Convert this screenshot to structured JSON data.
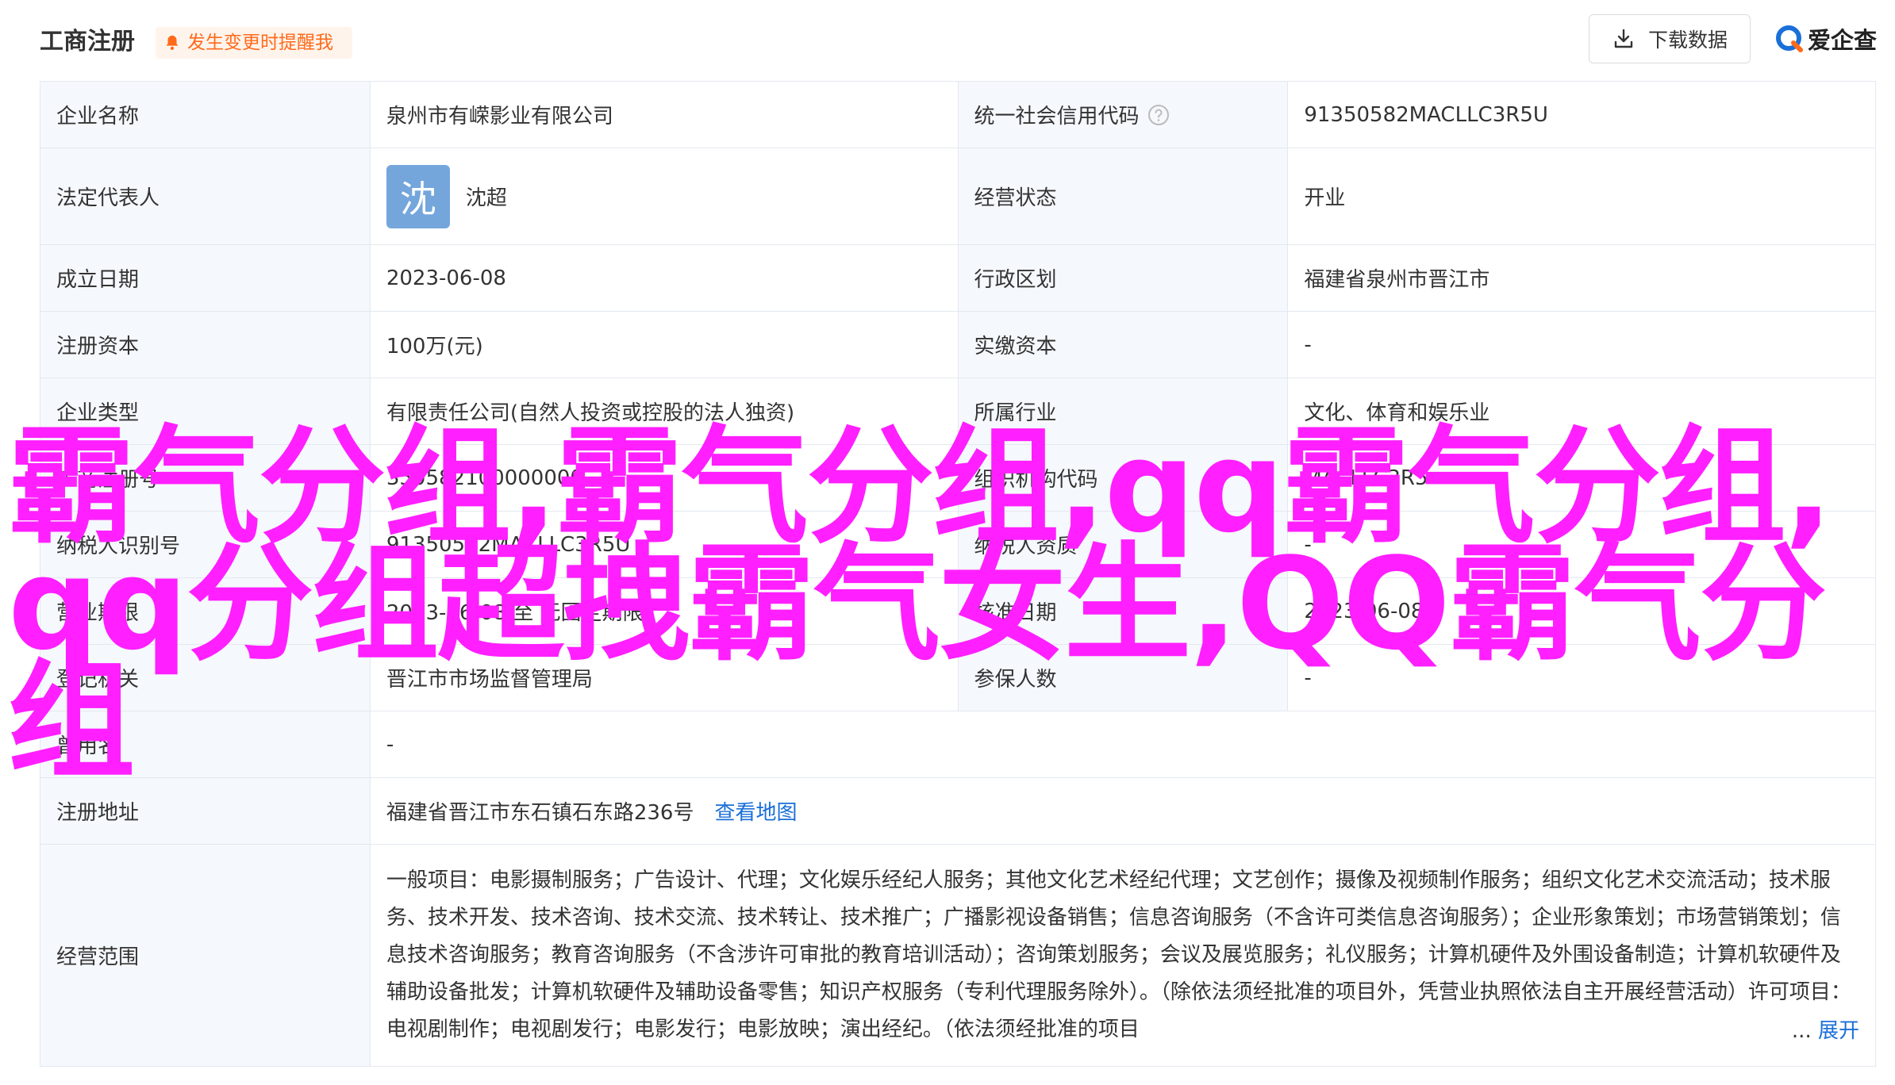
{
  "header": {
    "title": "工商注册",
    "alert_label": "发生变更时提醒我",
    "download_label": "下载数据",
    "brand_name": "爱企查",
    "brand_color": "#1a6fd8",
    "alert_color": "#ff6a1a"
  },
  "rows": [
    {
      "l1": "企业名称",
      "v1": "泉州市有嵘影业有限公司",
      "l2": "统一社会信用代码",
      "v2": "91350582MACLLC3R5U"
    },
    {
      "l1": "法定代表人",
      "avatar": "沈",
      "v1": "沈超",
      "l2": "经营状态",
      "v2": "开业"
    },
    {
      "l1": "成立日期",
      "v1": "2023-06-08",
      "l2": "行政区划",
      "v2": "福建省泉州市晋江市"
    },
    {
      "l1": "注册资本",
      "v1": "100万(元)",
      "l2": "实缴资本",
      "v2": "-"
    },
    {
      "l1": "企业类型",
      "v1": "有限责任公司(自然人投资或控股的法人独资)",
      "l2": "所属行业",
      "v2": "文化、体育和娱乐业"
    },
    {
      "l1": "工商注册号",
      "v1": "350582100000000",
      "l2": "组织机构代码",
      "v2": "MACLLC3R5"
    },
    {
      "l1": "纳税人识别号",
      "v1": "91350582MACLLC3R5U",
      "l2": "纳税人资质",
      "v2": "-"
    },
    {
      "l1": "营业期限",
      "v1": "2023-06-08 至 无固定期限",
      "l2": "核准日期",
      "v2": "2023-06-08"
    },
    {
      "l1": "登记机关",
      "v1": "晋江市市场监督管理局",
      "l2": "参保人数",
      "v2": "-"
    }
  ],
  "former_name": {
    "label": "曾用名",
    "value": "-"
  },
  "address": {
    "label": "注册地址",
    "value": "福建省晋江市东石镇石东路236号",
    "link": "查看地图"
  },
  "scope": {
    "label": "经营范围",
    "text": "一般项目：电影摄制服务；广告设计、代理；文化娱乐经纪人服务；其他文化艺术经纪代理；文艺创作；摄像及视频制作服务；组织文化艺术交流活动；技术服务、技术开发、技术咨询、技术交流、技术转让、技术推广；广播影视设备销售；信息咨询服务（不含许可类信息咨询服务）；企业形象策划；市场营销策划；信息技术咨询服务；教育咨询服务（不含涉许可审批的教育培训活动）；咨询策划服务；会议及展览服务；礼仪服务；计算机硬件及外围设备制造；计算机软硬件及辅助设备批发；计算机软硬件及辅助设备零售；知识产权服务（专利代理服务除外）。（除依法须经批准的项目外，凭营业执照依法自主开展经营活动）许可项目：电视剧制作；电视剧发行；电影发行；电影放映；演出经纪。（依法须经批准的项目",
    "ellipsis": "...",
    "expand": "展开"
  },
  "watermark": "霸气分组,霸气分组,qq霸气分组,\nqq分组超拽霸气女生,QQ霸气分组",
  "watermark_color": "#ff1fff"
}
